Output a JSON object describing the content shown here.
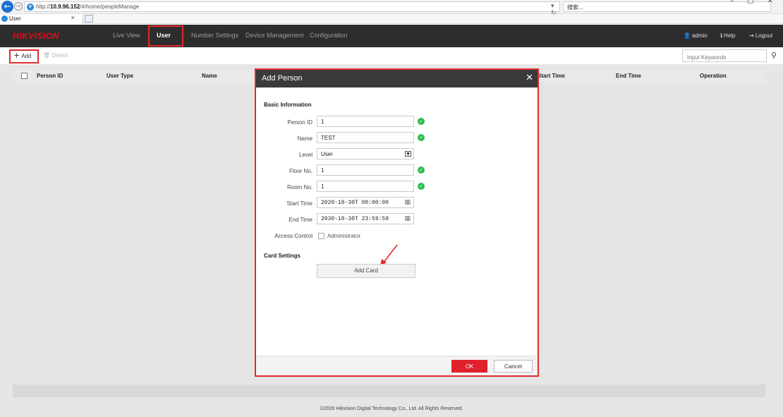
{
  "browser": {
    "url_prefix": "http://",
    "url_host": "10.9.96.152",
    "url_path": "/#/home/peopleManage",
    "search_placeholder": "搜索...",
    "tab_title": "User"
  },
  "header": {
    "logo": "HIKVISION",
    "nav": [
      "Live View",
      "User",
      "Number Settings",
      "Device Management",
      "Configuration"
    ],
    "active_nav": "User",
    "user": "admin",
    "help": "Help",
    "logout": "Logout"
  },
  "toolbar": {
    "add_label": "Add",
    "delete_label": "Delete",
    "search_placeholder": "Input Keywords"
  },
  "table": {
    "columns": [
      "Person ID",
      "User Type",
      "Name",
      "Start Time",
      "End Time",
      "Operation"
    ]
  },
  "modal": {
    "title": "Add Person",
    "basic_section": "Basic Information",
    "fields": {
      "person_id": {
        "label": "Person ID",
        "value": "1"
      },
      "name": {
        "label": "Name",
        "value": "TEST"
      },
      "level": {
        "label": "Level",
        "value": "User"
      },
      "floor_no": {
        "label": "Floor No.",
        "value": "1"
      },
      "room_no": {
        "label": "Room No.",
        "value": "1"
      },
      "start_time": {
        "label": "Start Time",
        "value": "2020-10-30T 00:00:00"
      },
      "end_time": {
        "label": "End Time",
        "value": "2030-10-30T 23:59:59"
      },
      "access_control": {
        "label": "Access Control",
        "option": "Administrator",
        "checked": false
      }
    },
    "card_section": "Card Settings",
    "add_card_label": "Add Card",
    "ok_label": "OK",
    "cancel_label": "Cancel"
  },
  "footer": {
    "copyright": "©2020 Hikvision Digital Technology Co., Ltd. All Rights Reserved."
  },
  "colors": {
    "accent_red": "#e0202a",
    "header_bg": "#2d2d2d",
    "valid_green": "#2ebb4d"
  }
}
